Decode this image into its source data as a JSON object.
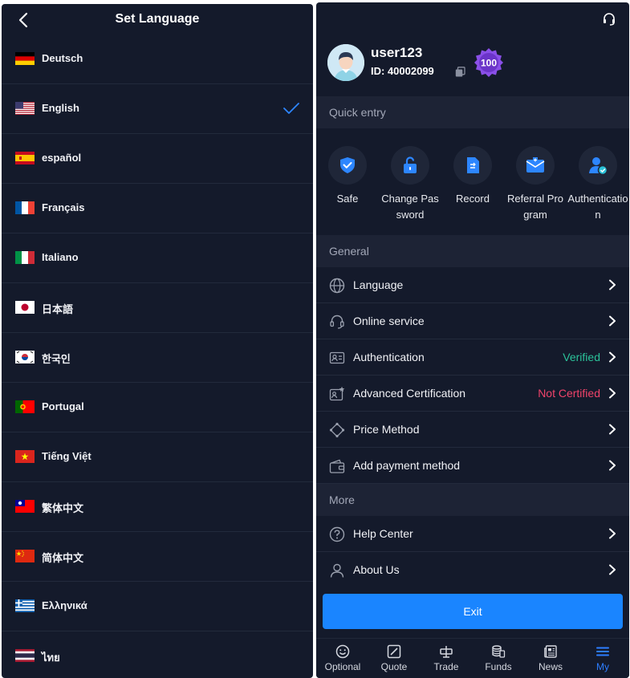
{
  "language_screen": {
    "title": "Set Language",
    "languages": [
      {
        "label": "Deutsch",
        "flag": "flag-de",
        "selected": false
      },
      {
        "label": "English",
        "flag": "flag-us",
        "selected": true
      },
      {
        "label": "español",
        "flag": "flag-es",
        "selected": false
      },
      {
        "label": "Français",
        "flag": "flag-fr",
        "selected": false
      },
      {
        "label": "Italiano",
        "flag": "flag-it",
        "selected": false
      },
      {
        "label": "日本語",
        "flag": "flag-jp",
        "selected": false
      },
      {
        "label": "한국인",
        "flag": "flag-kr",
        "selected": false
      },
      {
        "label": "Portugal",
        "flag": "flag-pt",
        "selected": false
      },
      {
        "label": "Tiếng Việt",
        "flag": "flag-vn",
        "selected": false
      },
      {
        "label": "繁体中文",
        "flag": "flag-tw",
        "selected": false
      },
      {
        "label": "简体中文",
        "flag": "flag-cn",
        "selected": false
      },
      {
        "label": "Ελληνικά",
        "flag": "flag-gr",
        "selected": false
      },
      {
        "label": "ไทย",
        "flag": "flag-th",
        "selected": false
      }
    ]
  },
  "profile": {
    "username": "user123",
    "id_text": "ID:  40002099",
    "vip_badge": "100"
  },
  "quick_entry": {
    "header": "Quick entry",
    "items": [
      {
        "label": "Safe",
        "icon": "shield-check-icon"
      },
      {
        "label": "Change Password",
        "icon": "unlock-icon"
      },
      {
        "label": "Record",
        "icon": "document-icon"
      },
      {
        "label": "Referral Program",
        "icon": "envelope-icon"
      },
      {
        "label": "Authentication",
        "icon": "user-verified-icon"
      }
    ]
  },
  "general": {
    "header": "General",
    "items": [
      {
        "label": "Language",
        "icon": "globe-icon",
        "status": ""
      },
      {
        "label": "Online service",
        "icon": "headset-icon",
        "status": ""
      },
      {
        "label": "Authentication",
        "icon": "id-card-icon",
        "status": "Verified"
      },
      {
        "label": "Advanced Certification",
        "icon": "id-star-icon",
        "status": "Not Certified"
      },
      {
        "label": "Price Method",
        "icon": "diamond-icon",
        "status": ""
      },
      {
        "label": "Add payment method",
        "icon": "wallet-icon",
        "status": ""
      }
    ]
  },
  "more": {
    "header": "More",
    "items": [
      {
        "label": "Help Center",
        "icon": "question-icon"
      },
      {
        "label": "About Us",
        "icon": "person-icon"
      }
    ]
  },
  "exit_label": "Exit",
  "tabs": [
    {
      "label": "Optional",
      "icon": "smile-icon"
    },
    {
      "label": "Quote",
      "icon": "chart-slash-icon"
    },
    {
      "label": "Trade",
      "icon": "trade-icon"
    },
    {
      "label": "Funds",
      "icon": "coins-icon"
    },
    {
      "label": "News",
      "icon": "newspaper-icon"
    },
    {
      "label": "My",
      "icon": "menu-lines-icon",
      "active": true
    }
  ],
  "colors": {
    "background": "#141a2b",
    "section": "#1d2335",
    "accent": "#1a85ff",
    "verified": "#2bc29a",
    "not_certified": "#f0436a"
  }
}
